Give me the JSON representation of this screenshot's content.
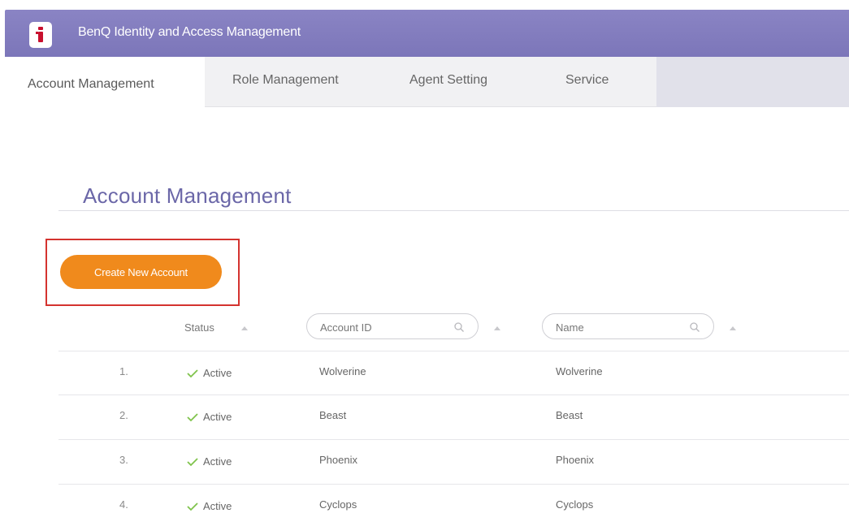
{
  "app": {
    "title": "BenQ Identity and Access Management"
  },
  "tabs": [
    {
      "label": "Account Management",
      "active": true
    },
    {
      "label": "Role Management",
      "active": false
    },
    {
      "label": "Agent Setting",
      "active": false
    },
    {
      "label": "Service",
      "active": false
    }
  ],
  "page": {
    "title": "Account Management",
    "create_button_label": "Create New Account"
  },
  "table": {
    "columns": {
      "status": "Status",
      "account_id_placeholder": "Account ID",
      "name_placeholder": "Name"
    },
    "rows": [
      {
        "index": "1.",
        "status": "Active",
        "account_id": "Wolverine",
        "name": "Wolverine"
      },
      {
        "index": "2.",
        "status": "Active",
        "account_id": "Beast",
        "name": "Beast"
      },
      {
        "index": "3.",
        "status": "Active",
        "account_id": "Phoenix",
        "name": "Phoenix"
      },
      {
        "index": "4.",
        "status": "Active",
        "account_id": "Cyclops",
        "name": "Cyclops"
      }
    ]
  },
  "colors": {
    "header": "#8a84c4",
    "accent_button": "#f08a1c",
    "title_text": "#6b67a8",
    "highlight_border": "#d4332f",
    "active_check": "#7fc34b"
  },
  "icons": {
    "logo": "benq-logo-icon",
    "search": "search-icon",
    "sort": "sort-up-icon",
    "status": "check-icon"
  }
}
